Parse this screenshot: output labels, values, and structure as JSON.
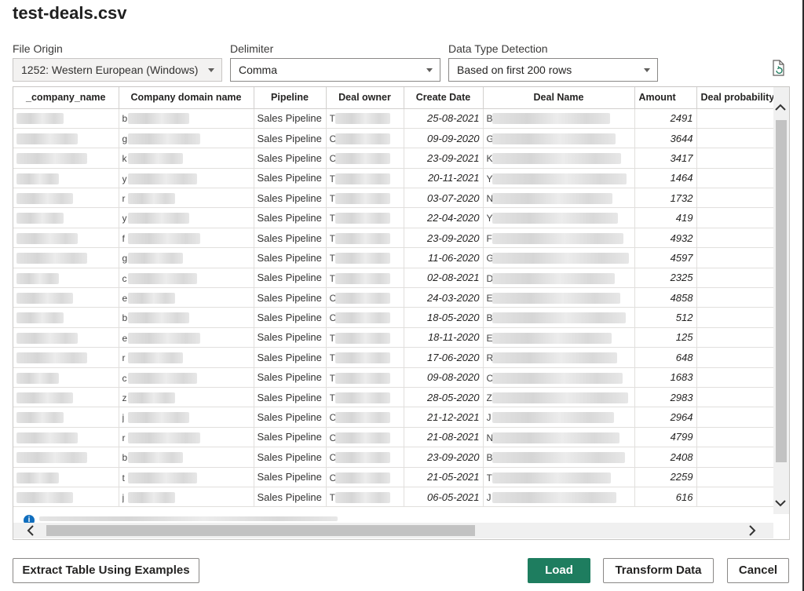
{
  "dialog": {
    "title": "test-deals.csv"
  },
  "options": {
    "file_origin": {
      "label": "File Origin",
      "value": "1252: Western European (Windows)"
    },
    "delimiter": {
      "label": "Delimiter",
      "value": "Comma"
    },
    "data_type_detection": {
      "label": "Data Type Detection",
      "value": "Based on first 200 rows"
    }
  },
  "table": {
    "columns": [
      "_company_name",
      "Company domain name",
      "Pipeline",
      "Deal owner",
      "Create Date",
      "Deal Name",
      "Amount",
      "Deal probability"
    ],
    "rows": [
      {
        "domain_prefix": "b",
        "pipeline": "Sales Pipeline",
        "owner_prefix": "T",
        "date": "25-08-2021",
        "name_prefix": "B",
        "amount": "2491"
      },
      {
        "domain_prefix": "g",
        "pipeline": "Sales Pipeline",
        "owner_prefix": "C",
        "date": "09-09-2020",
        "name_prefix": "G",
        "amount": "3644"
      },
      {
        "domain_prefix": "k",
        "pipeline": "Sales Pipeline",
        "owner_prefix": "C",
        "date": "23-09-2021",
        "name_prefix": "K",
        "amount": "3417"
      },
      {
        "domain_prefix": "y",
        "pipeline": "Sales Pipeline",
        "owner_prefix": "T",
        "date": "20-11-2021",
        "name_prefix": "Y",
        "amount": "1464"
      },
      {
        "domain_prefix": "r",
        "pipeline": "Sales Pipeline",
        "owner_prefix": "T",
        "date": "03-07-2020",
        "name_prefix": "N",
        "amount": "1732"
      },
      {
        "domain_prefix": "y",
        "pipeline": "Sales Pipeline",
        "owner_prefix": "T",
        "date": "22-04-2020",
        "name_prefix": "Y",
        "amount": "419"
      },
      {
        "domain_prefix": "f",
        "pipeline": "Sales Pipeline",
        "owner_prefix": "T",
        "date": "23-09-2020",
        "name_prefix": "F",
        "amount": "4932"
      },
      {
        "domain_prefix": "g",
        "pipeline": "Sales Pipeline",
        "owner_prefix": "T",
        "date": "11-06-2020",
        "name_prefix": "G",
        "amount": "4597"
      },
      {
        "domain_prefix": "c",
        "pipeline": "Sales Pipeline",
        "owner_prefix": "T",
        "date": "02-08-2021",
        "name_prefix": "D",
        "amount": "2325"
      },
      {
        "domain_prefix": "e",
        "pipeline": "Sales Pipeline",
        "owner_prefix": "C",
        "date": "24-03-2020",
        "name_prefix": "E",
        "amount": "4858"
      },
      {
        "domain_prefix": "b",
        "pipeline": "Sales Pipeline",
        "owner_prefix": "C",
        "date": "18-05-2020",
        "name_prefix": "B",
        "amount": "512"
      },
      {
        "domain_prefix": "e",
        "pipeline": "Sales Pipeline",
        "owner_prefix": "T",
        "date": "18-11-2020",
        "name_prefix": "E",
        "amount": "125"
      },
      {
        "domain_prefix": "r",
        "pipeline": "Sales Pipeline",
        "owner_prefix": "T",
        "date": "17-06-2020",
        "name_prefix": "R",
        "amount": "648"
      },
      {
        "domain_prefix": "c",
        "pipeline": "Sales Pipeline",
        "owner_prefix": "T",
        "date": "09-08-2020",
        "name_prefix": "C",
        "amount": "1683"
      },
      {
        "domain_prefix": "z",
        "pipeline": "Sales Pipeline",
        "owner_prefix": "T",
        "date": "28-05-2020",
        "name_prefix": "Z",
        "amount": "2983"
      },
      {
        "domain_prefix": "j",
        "pipeline": "Sales Pipeline",
        "owner_prefix": "C",
        "date": "21-12-2021",
        "name_prefix": "J",
        "amount": "2964"
      },
      {
        "domain_prefix": "r",
        "pipeline": "Sales Pipeline",
        "owner_prefix": "C",
        "date": "21-08-2021",
        "name_prefix": "N",
        "amount": "4799"
      },
      {
        "domain_prefix": "b",
        "pipeline": "Sales Pipeline",
        "owner_prefix": "C",
        "date": "23-09-2020",
        "name_prefix": "B",
        "amount": "2408"
      },
      {
        "domain_prefix": "t",
        "pipeline": "Sales Pipeline",
        "owner_prefix": "C",
        "date": "21-05-2021",
        "name_prefix": "T",
        "amount": "2259"
      },
      {
        "domain_prefix": "j",
        "pipeline": "Sales Pipeline",
        "owner_prefix": "T",
        "date": "06-05-2021",
        "name_prefix": "J",
        "amount": "616"
      }
    ]
  },
  "icons": {
    "info": "info-icon",
    "refresh": "refresh-icon",
    "scroll_up": "chevron-up-icon",
    "scroll_down": "chevron-down-icon",
    "scroll_left": "chevron-left-icon",
    "scroll_right": "chevron-right-icon"
  },
  "buttons": {
    "extract": "Extract Table Using Examples",
    "load": "Load",
    "transform": "Transform Data",
    "cancel": "Cancel"
  },
  "colors": {
    "primary_button": "#1e7d5f",
    "info": "#106ebe"
  }
}
